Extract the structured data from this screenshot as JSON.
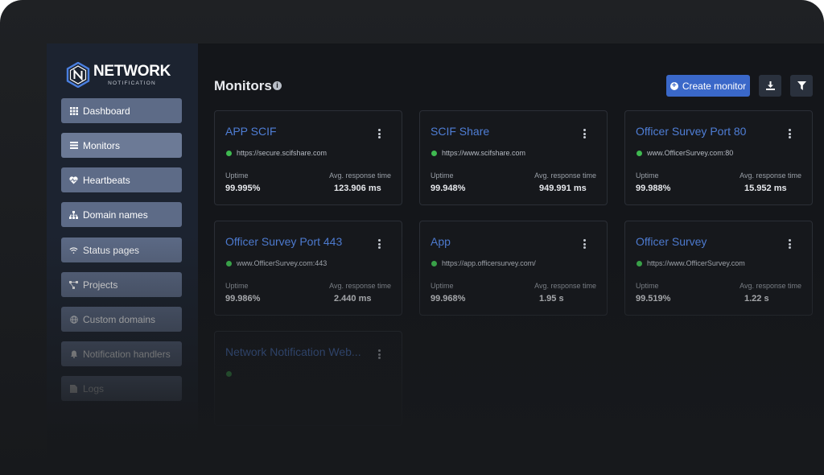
{
  "brand": {
    "title": "NETWORK",
    "subtitle": "NOTIFICATION"
  },
  "sidebar": {
    "items": [
      {
        "label": "Dashboard",
        "icon": "grid-icon"
      },
      {
        "label": "Monitors",
        "icon": "list-icon"
      },
      {
        "label": "Heartbeats",
        "icon": "heart-icon"
      },
      {
        "label": "Domain names",
        "icon": "sitemap-icon"
      },
      {
        "label": "Status pages",
        "icon": "wifi-icon"
      },
      {
        "label": "Projects",
        "icon": "project-diagram-icon"
      },
      {
        "label": "Custom domains",
        "icon": "globe-icon"
      },
      {
        "label": "Notification handlers",
        "icon": "bell-icon"
      },
      {
        "label": "Logs",
        "icon": "file-icon"
      }
    ]
  },
  "header": {
    "title": "Monitors",
    "create_label": "Create monitor"
  },
  "labels": {
    "uptime": "Uptime",
    "response": "Avg. response time"
  },
  "monitors": [
    {
      "name": "APP SCIF",
      "url": "https://secure.scifshare.com",
      "uptime": "99.995%",
      "response": "123.906 ms",
      "status": "up"
    },
    {
      "name": "SCIF Share",
      "url": "https://www.scifshare.com",
      "uptime": "99.948%",
      "response": "949.991 ms",
      "status": "up"
    },
    {
      "name": "Officer Survey Port 80",
      "url": "www.OfficerSurvey.com:80",
      "uptime": "99.988%",
      "response": "15.952 ms",
      "status": "up"
    },
    {
      "name": "Officer Survey Port 443",
      "url": "www.OfficerSurvey.com:443",
      "uptime": "99.986%",
      "response": "2.440 ms",
      "status": "up"
    },
    {
      "name": "App",
      "url": "https://app.officersurvey.com/",
      "uptime": "99.968%",
      "response": "1.95 s",
      "status": "up"
    },
    {
      "name": "Officer Survey",
      "url": "https://www.OfficerSurvey.com",
      "uptime": "99.519%",
      "response": "1.22 s",
      "status": "up"
    },
    {
      "name": "Network Notification Web...",
      "url": "",
      "uptime": "",
      "response": "",
      "status": "up"
    }
  ],
  "colors": {
    "accent": "#3a68c9",
    "link": "#4f7ed6",
    "status_up": "#3fb950",
    "nav_bg": "#5d6b87"
  }
}
